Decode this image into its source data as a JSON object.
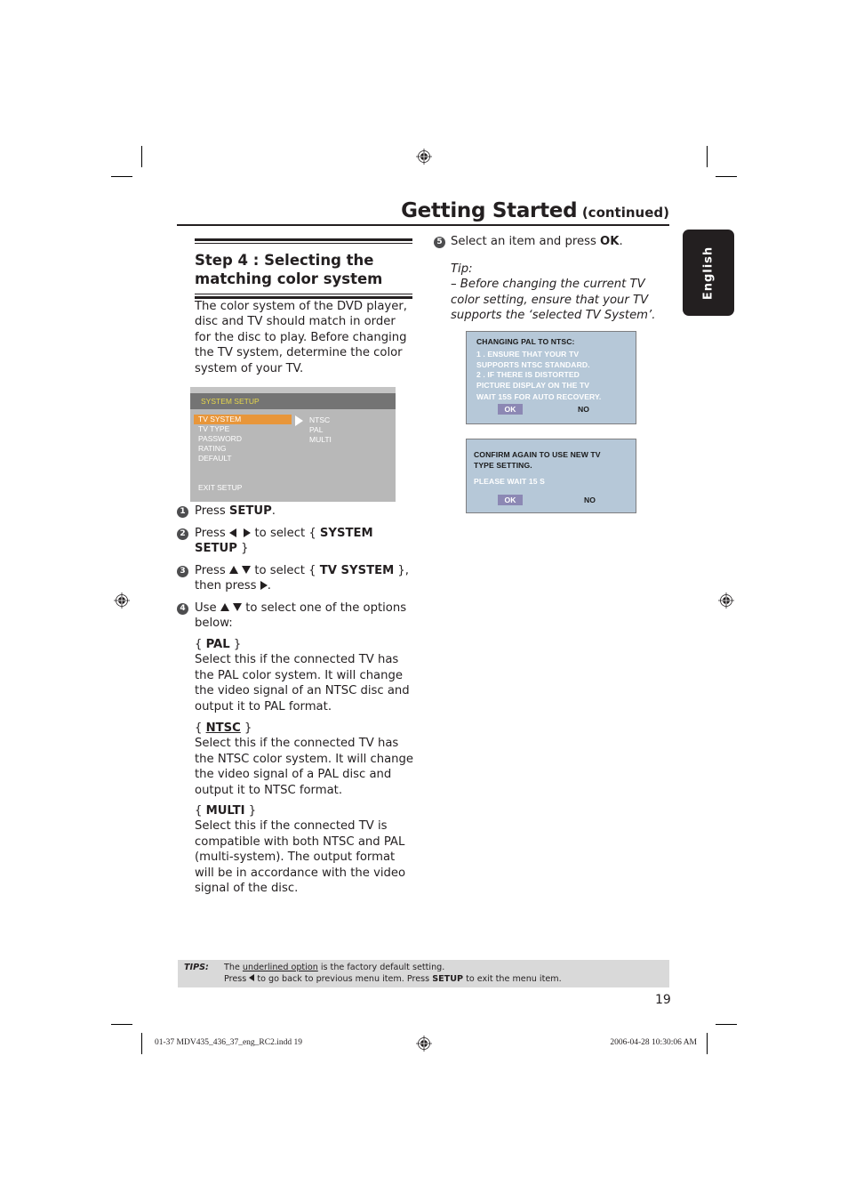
{
  "header": {
    "title": "Getting Started",
    "subtitle": "(continued)"
  },
  "language_tab": {
    "label": "English"
  },
  "step_section": {
    "title_line1": "Step 4 : Selecting the",
    "title_line2": "matching color system",
    "intro": "The color system of the DVD player, disc and TV should match in order for the disc to play. Before changing the TV system, determine the color system of your TV."
  },
  "osd_menu": {
    "title": "SYSTEM SETUP",
    "items": [
      "TV SYSTEM",
      "TV TYPE",
      "PASSWORD",
      "RATING",
      "DEFAULT"
    ],
    "selected_item": "TV SYSTEM",
    "options": [
      "NTSC",
      "PAL",
      "MULTI"
    ],
    "exit": "EXIT SETUP",
    "colors": {
      "bar": "#747474",
      "title_text": "#e8d84a",
      "highlight": "#e8963a",
      "panel": "#b8b8b8"
    }
  },
  "steps": [
    {
      "num": "1",
      "pre": "Press ",
      "bold": "SETUP",
      "post": "."
    },
    {
      "num": "2",
      "pre": "Press",
      "mid": "to select {",
      "bold": "SYSTEM SETUP",
      "post": "}"
    },
    {
      "num": "3",
      "pre": "Press",
      "mid": "to select {",
      "bold": "TV SYSTEM",
      "post": "},",
      "line2_pre": "then press",
      "line2_post": "."
    },
    {
      "num": "4",
      "pre": "Use",
      "mid": "to select one of the options below:"
    },
    {
      "num": "5",
      "pre": "Select an item and press ",
      "bold": "OK",
      "post": "."
    }
  ],
  "options": [
    {
      "name": "PAL",
      "default": false,
      "desc": "Select this if the connected TV has the PAL color system. It will change the video signal of an NTSC disc and output it to PAL format."
    },
    {
      "name": "NTSC",
      "default": true,
      "desc": "Select this if the connected TV has the NTSC color system. It will change the video signal of a PAL disc and output it to NTSC format."
    },
    {
      "name": "MULTI",
      "default": false,
      "desc": "Select this if the connected TV is compatible with both NTSC and PAL (multi-system). The output format will be in accordance with the video signal of the disc."
    }
  ],
  "tip": {
    "label": "Tip:",
    "text": "– Before changing the current TV color setting, ensure that your TV supports the ‘selected TV System’."
  },
  "dialog1": {
    "title": "CHANGING  PAL TO NTSC:",
    "lines": [
      "1 . ENSURE  THAT  YOUR  TV",
      "SUPPORTS  NTSC  STANDARD.",
      "2 . IF  THERE IS  DISTORTED",
      "PICTURE  DISPLAY  ON  THE  TV",
      "WAIT  15S  FOR  AUTO  RECOVERY."
    ],
    "ok": "OK",
    "no": "NO"
  },
  "dialog2": {
    "lines": [
      "CONFIRM  AGAIN  TO  USE  NEW  TV",
      "TYPE  SETTING."
    ],
    "wait": "PLEASE WAIT    15  S",
    "ok": "OK",
    "no": "NO",
    "colors": {
      "panel": "#b6c8d8",
      "ok_button": "#8c88b4"
    }
  },
  "tips_bar": {
    "label": "TIPS:",
    "line1_pre": "The ",
    "line1_underlined": "underlined option",
    "line1_post": " is the factory default setting.",
    "line2_pre": "Press ",
    "line2_mid": " to go back to previous menu item. Press ",
    "line2_bold": "SETUP",
    "line2_post": " to exit the menu item."
  },
  "page_number": "19",
  "footer": {
    "file": "01-37 MDV435_436_37_eng_RC2.indd   19",
    "timestamp": "2006-04-28   10:30:06 AM"
  }
}
